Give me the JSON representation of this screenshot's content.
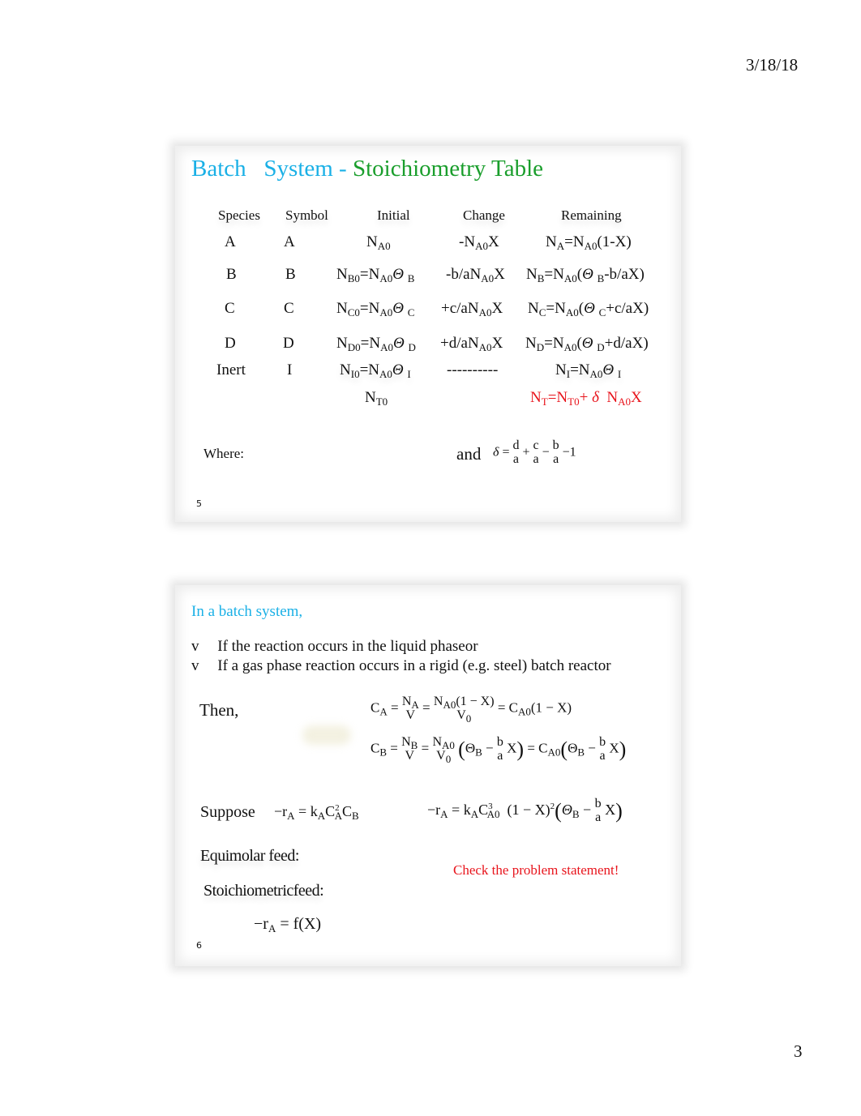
{
  "page": {
    "date": "3/18/18",
    "page_number": "3"
  },
  "slide5": {
    "title_part1": "Batch",
    "title_part2": "System -",
    "title_part3": "Stoichiometry Table",
    "headers": [
      "Species",
      "Symbol",
      "Initial",
      "Change",
      "Remaining"
    ],
    "rows": [
      {
        "species": "A",
        "symbol": "A",
        "initial": "N_A0",
        "change": "-N_A0 X",
        "remaining": "N_A=N_A0(1-X)"
      },
      {
        "species": "B",
        "symbol": "B",
        "initial": "N_B0=N_A0 Θ_B",
        "change": "-b/aN_A0 X",
        "remaining": "N_B=N_A0(Θ_B-b/aX)"
      },
      {
        "species": "C",
        "symbol": "C",
        "initial": "N_C0=N_A0 Θ_C",
        "change": "+c/aN_A0 X",
        "remaining": "N_C=N_A0(Θ_C+c/aX)"
      },
      {
        "species": "D",
        "symbol": "D",
        "initial": "N_D0=N_A0 Θ_D",
        "change": "+d/aN_A0 X",
        "remaining": "N_D=N_A0(Θ_D+d/aX)"
      },
      {
        "species": "Inert",
        "symbol": "I",
        "initial": "N_I0=N_A0 Θ_I",
        "change": "----------",
        "remaining": "N_I=N_A0 Θ_I"
      }
    ],
    "total_initial": "N_T0",
    "total_remaining": "N_T=N_T0+δ N_A0 X",
    "where_label": "Where:",
    "and_label": "and",
    "delta_formula": "δ = d/a + c/a − b/a − 1",
    "slide_number": "5",
    "labels": {
      "A": "A",
      "B": "B",
      "C": "C",
      "D": "D",
      "Inert": "Inert",
      "I": "I",
      "N": "N",
      "A0": "A0",
      "B0": "B0",
      "C0": "C0",
      "D0": "D0",
      "I0": "I0",
      "T0": "T0",
      "T": "T",
      "theta": "Θ",
      "X": "X",
      "dashes": "----------",
      "delta": "δ",
      "d": "d",
      "c": "c",
      "b": "b",
      "a": "a"
    }
  },
  "slide6": {
    "heading": "In a batch system,",
    "bullet_glyph": "v",
    "bullets": [
      "If the reaction occurs in the liquid phaseor",
      "If a gas phase reaction occurs in a rigid (e.g. steel) batch reactor"
    ],
    "then_label": "Then,",
    "eq_CA": "C_A = N_A/V = N_A0(1 − X)/V_0 = C_A0(1 − X)",
    "eq_CB": "C_B = N_B/V = N_A0/V_0 (Θ_B − b/a X) = C_A0(Θ_B − b/a X)",
    "suppose_label": "Suppose",
    "rate_law": "−r_A = k_A C_A^2 C_B",
    "rate_expanded": "−r_A = k_A C_A0^3 (1 − X)^2 (Θ_B − b/a X)",
    "equimolar_label": "Equimolar feed:",
    "stoichiometric_label": "Stoichiometricfeed:",
    "note": "Check the problem statement!",
    "rate_function": "−r_A = f(X)",
    "slide_number": "6"
  },
  "colors": {
    "title_blue": "#1ab0e6",
    "title_green": "#1a9e2c",
    "highlight_red": "#e8141c"
  }
}
